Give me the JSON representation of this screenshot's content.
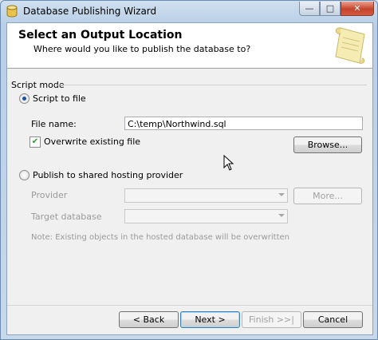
{
  "window": {
    "title": "Database Publishing Wizard"
  },
  "header": {
    "title": "Select an Output Location",
    "subtitle": "Where would you like to publish the database to?"
  },
  "script_mode": {
    "group_label": "Script mode",
    "script_to_file_label": "Script to file",
    "script_to_file_checked": true,
    "file_name_label": "File name:",
    "file_name_value": "C:\\temp\\Northwind.sql",
    "overwrite_label": "Overwrite existing file",
    "overwrite_checked": true,
    "browse_label": "Browse..."
  },
  "hosting": {
    "publish_label": "Publish to shared hosting provider",
    "publish_checked": false,
    "provider_label": "Provider",
    "provider_value": "",
    "more_label": "More...",
    "target_db_label": "Target database",
    "target_db_value": "",
    "note": "Note: Existing objects in the hosted database will be overwritten"
  },
  "footer": {
    "back_label": "< Back",
    "next_label": "Next >",
    "finish_label": "Finish >>|",
    "cancel_label": "Cancel"
  },
  "colors": {
    "title_bar": "#b9cfe6",
    "radio_dot": "#1b4fa0",
    "close_button": "#c5432b"
  },
  "icons": {
    "app": "database-icon",
    "header": "scroll-icon",
    "pointer": "mouse-cursor-icon"
  }
}
